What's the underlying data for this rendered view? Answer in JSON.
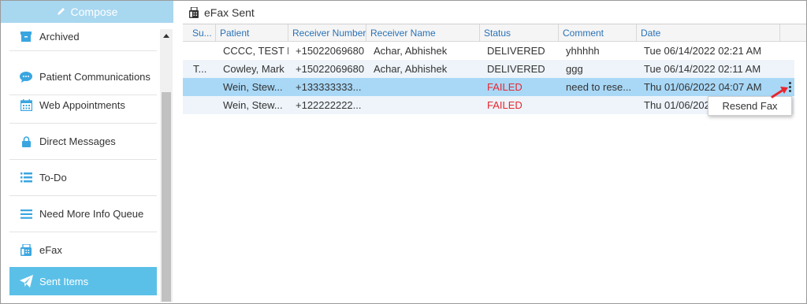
{
  "sidebar": {
    "compose_label": "Compose",
    "items": [
      {
        "label": "Archived",
        "icon": "archive-box-icon"
      },
      {
        "label": "Patient Communications",
        "icon": "chat-bubble-icon"
      },
      {
        "label": "Web Appointments",
        "icon": "calendar-icon"
      },
      {
        "label": "Direct Messages",
        "icon": "lock-icon"
      },
      {
        "label": "To-Do",
        "icon": "checklist-icon"
      },
      {
        "label": "Need More Info Queue",
        "icon": "list-icon"
      },
      {
        "label": "eFax",
        "icon": "fax-icon"
      },
      {
        "label": "Sent Items",
        "icon": "paper-plane-icon",
        "active": true
      }
    ]
  },
  "main": {
    "title": "eFax Sent",
    "columns": [
      "Su...",
      "Patient",
      "Receiver Number",
      "Receiver Name",
      "Status",
      "Comment",
      "Date"
    ],
    "rows": [
      {
        "subject": "",
        "patient": "CCCC, TEST E",
        "number": "+15022069680",
        "name": "Achar, Abhishek",
        "status": "DELIVERED",
        "comment": "yhhhhh",
        "date": "Tue 06/14/2022 02:21 AM"
      },
      {
        "subject": "T...",
        "patient": "Cowley, Mark",
        "number": "+15022069680",
        "name": "Achar, Abhishek",
        "status": "DELIVERED",
        "comment": "ggg",
        "date": "Tue 06/14/2022 02:11 AM"
      },
      {
        "subject": "",
        "patient": "Wein, Stew...",
        "number": "+133333333...",
        "name": "",
        "status": "FAILED",
        "comment": "need to rese...",
        "date": "Thu 01/06/2022 04:07 AM"
      },
      {
        "subject": "",
        "patient": "Wein, Stew...",
        "number": "+122222222...",
        "name": "",
        "status": "FAILED",
        "comment": "",
        "date": "Thu 01/06/2022"
      }
    ],
    "context_menu": {
      "item": "Resend Fax"
    }
  },
  "colors": {
    "compose_bg": "#a8d7f0",
    "active_nav": "#5bc0e8",
    "selected_row": "#a9d8f7",
    "header_text": "#2a72b5",
    "failed": "#e8262f",
    "icon_blue": "#3aa6e0"
  }
}
